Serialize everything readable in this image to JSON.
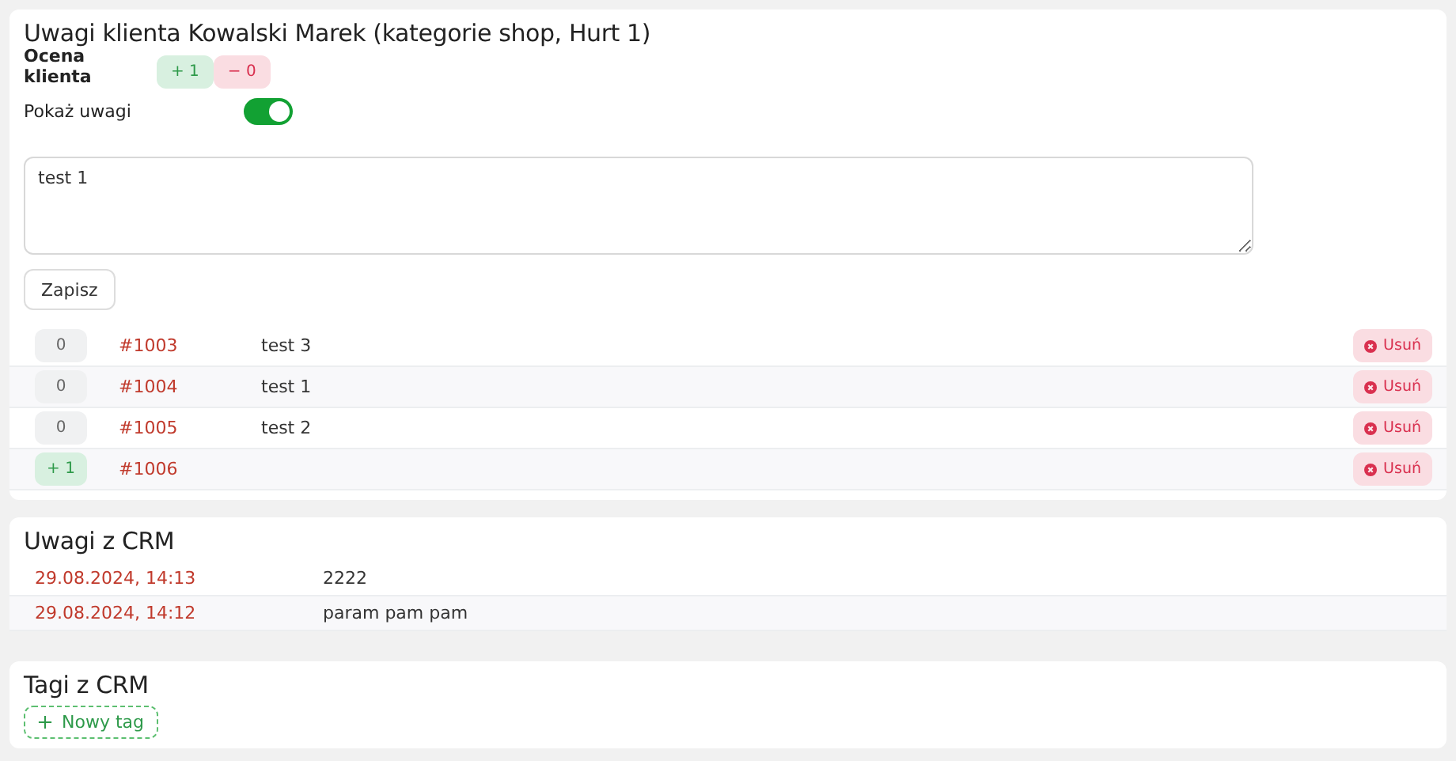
{
  "client_notes": {
    "title": "Uwagi klienta Kowalski Marek (kategorie shop, Hurt 1)",
    "rating_label": "Ocena klienta",
    "rating": [
      {
        "label": "+ 1",
        "kind": "positive"
      },
      {
        "label": "− 0",
        "kind": "negative"
      }
    ],
    "show_label": "Pokaż uwagi",
    "show_notes": true,
    "note": {
      "value": "test 1"
    },
    "save_button": "Zapisz",
    "rows": [
      {
        "score": "0",
        "kind": "neutral",
        "order": "#1003",
        "text": "test 3",
        "delete": "Usuń"
      },
      {
        "score": "0",
        "kind": "neutral",
        "order": "#1004",
        "text": "test 1",
        "delete": "Usuń"
      },
      {
        "score": "0",
        "kind": "neutral",
        "order": "#1005",
        "text": "test 2",
        "delete": "Usuń"
      },
      {
        "score": "+ 1",
        "kind": "positive",
        "order": "#1006",
        "delete": "Usuń"
      }
    ]
  },
  "crm_notes": {
    "title": "Uwagi z CRM",
    "rows": [
      {
        "date": "29.08.2024, 14:13",
        "text": "2222"
      },
      {
        "date": "29.08.2024, 14:12",
        "text": "param pam pam"
      }
    ]
  },
  "crm_tags": {
    "title": "Tagi z CRM",
    "new_tag": "Nowy tag"
  }
}
